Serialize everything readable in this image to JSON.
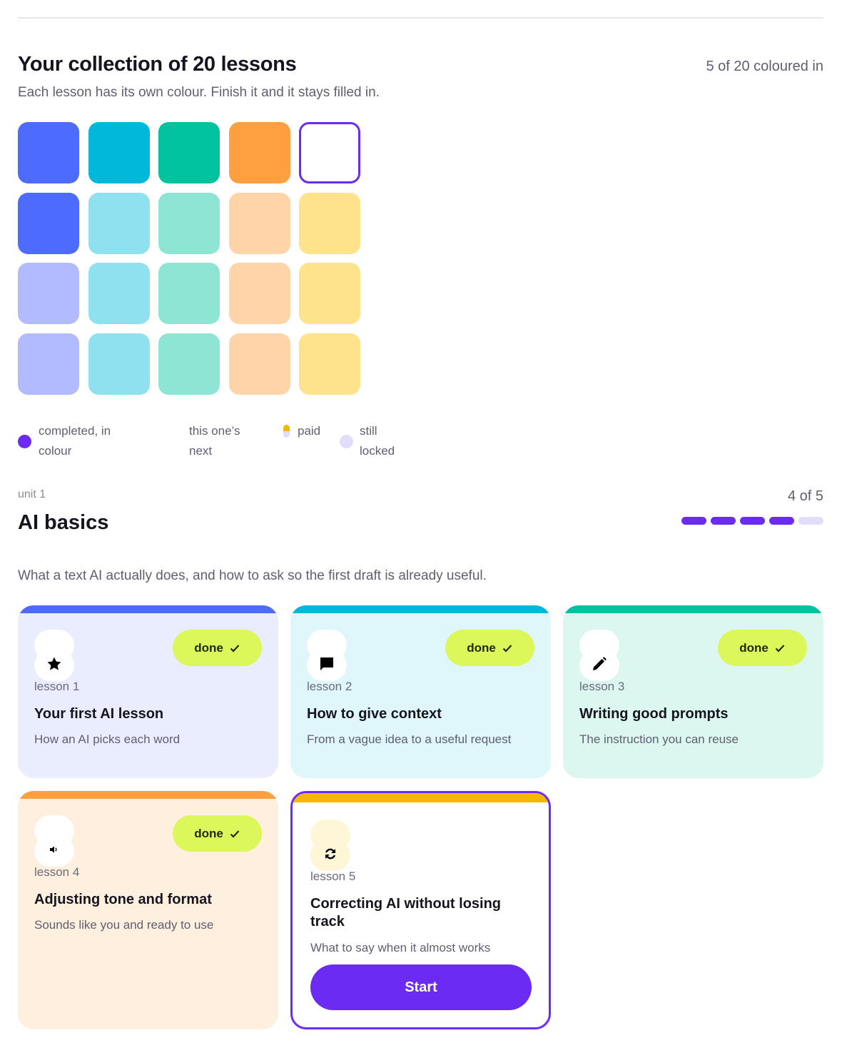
{
  "collection": {
    "title": "Your collection of 20 lessons",
    "count_label": "5 of 20 coloured in",
    "subtitle": "Each lesson has its own colour. Finish it and it stays filled in.",
    "tiles": [
      {
        "state": "completed",
        "color": "#4d6bff"
      },
      {
        "state": "completed",
        "color": "#00b8d9"
      },
      {
        "state": "completed",
        "color": "#00c29e"
      },
      {
        "state": "completed",
        "color": "#ff9f3f"
      },
      {
        "state": "next",
        "color": "#ffffff"
      },
      {
        "state": "completed",
        "color": "#4d6bff"
      },
      {
        "state": "locked",
        "color": "#8fe1ef"
      },
      {
        "state": "locked",
        "color": "#8fe5d4"
      },
      {
        "state": "locked",
        "color": "#ffd4a8"
      },
      {
        "state": "locked",
        "color": "#ffe38c"
      },
      {
        "state": "locked",
        "color": "#b2bbff"
      },
      {
        "state": "locked",
        "color": "#8fe1ef"
      },
      {
        "state": "locked",
        "color": "#8fe5d4"
      },
      {
        "state": "locked",
        "color": "#ffd4a8"
      },
      {
        "state": "locked",
        "color": "#ffe38c"
      },
      {
        "state": "locked",
        "color": "#b2bbff"
      },
      {
        "state": "locked",
        "color": "#8fe1ef"
      },
      {
        "state": "locked",
        "color": "#8fe5d4"
      },
      {
        "state": "locked",
        "color": "#ffd4a8"
      },
      {
        "state": "locked",
        "color": "#ffe38c"
      }
    ]
  },
  "legend": {
    "completed": "completed, in colour",
    "next": "this one’s next",
    "paid": "paid",
    "locked": "still locked"
  },
  "unit": {
    "kicker": "unit 1",
    "title": "AI basics",
    "count_label": "4 of 5",
    "subtitle": "What a text AI actually does, and how to ask so the first draft is already useful.",
    "progress": {
      "completed": 4,
      "total": 5
    }
  },
  "lessons": [
    {
      "kicker": "lesson 1",
      "title": "Your first AI lesson",
      "subtitle": "How an AI picks each word",
      "status": "done",
      "icon": "star-icon"
    },
    {
      "kicker": "lesson 2",
      "title": "How to give context",
      "subtitle": "From a vague idea to a useful request",
      "status": "done",
      "icon": "chat-bubble-icon"
    },
    {
      "kicker": "lesson 3",
      "title": "Writing good prompts",
      "subtitle": "The instruction you can reuse",
      "status": "done",
      "icon": "pencil-icon"
    },
    {
      "kicker": "lesson 4",
      "title": "Adjusting tone and format",
      "subtitle": "Sounds like you and ready to use",
      "status": "done",
      "icon": "speaker-icon"
    },
    {
      "kicker": "lesson 5",
      "title": "Correcting AI without losing track",
      "subtitle": "What to say when it almost works",
      "status": "next",
      "icon": "refresh-icon"
    }
  ],
  "labels": {
    "done": "done",
    "start": "Start"
  },
  "colors": {
    "accent": "#6c2bf2",
    "done_pill": "#dcf75a",
    "paid": "#f5b800",
    "locked_dot": "#e3dcfb",
    "progress_empty": "#e3dcfb"
  }
}
